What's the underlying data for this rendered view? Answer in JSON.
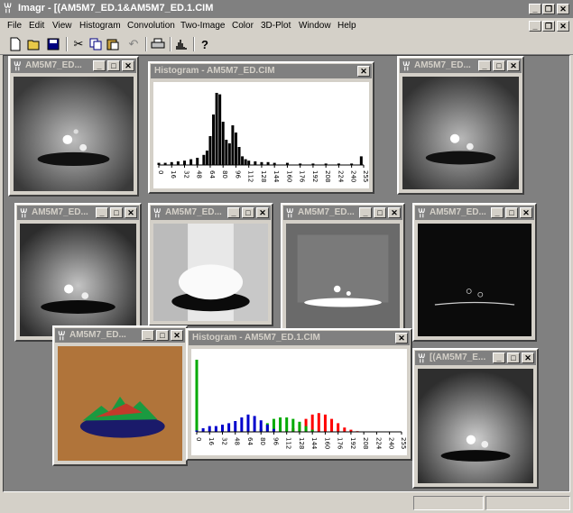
{
  "app": {
    "title": "Imagr - [(AM5M7_ED.1&AM5M7_ED.1.CIM",
    "icon": "app-icon"
  },
  "menu": [
    "File",
    "Edit",
    "View",
    "Histogram",
    "Convolution",
    "Two-Image",
    "Color",
    "3D-Plot",
    "Window",
    "Help"
  ],
  "toolbar": [
    "new-file-icon",
    "open-folder-icon",
    "save-disk-icon",
    "cut-icon",
    "copy-icon",
    "paste-icon",
    "undo-icon",
    "print-icon",
    "histogram-icon",
    "help-icon"
  ],
  "windows": {
    "img1": {
      "title": "AM5M7_ED..."
    },
    "hist1": {
      "title": "Histogram - AM5M7_ED.CIM",
      "ticks": [
        "0",
        "16",
        "32",
        "48",
        "64",
        "80",
        "96",
        "112",
        "128",
        "144",
        "160",
        "176",
        "192",
        "208",
        "224",
        "240",
        "255"
      ]
    },
    "img2": {
      "title": "AM5M7_ED..."
    },
    "img3": {
      "title": "AM5M7_ED..."
    },
    "img4": {
      "title": "AM5M7_ED..."
    },
    "img5": {
      "title": "AM5M7_ED..."
    },
    "img6": {
      "title": "AM5M7_ED..."
    },
    "img7": {
      "title": "AM5M7_ED..."
    },
    "hist2": {
      "title": "Histogram - AM5M7_ED.1.CIM",
      "ticks": [
        "0",
        "16",
        "32",
        "48",
        "64",
        "80",
        "96",
        "112",
        "128",
        "144",
        "160",
        "176",
        "192",
        "208",
        "224",
        "240",
        "255"
      ]
    },
    "img8": {
      "title": "[(AM5M7_E..."
    }
  },
  "colors": {
    "inactive_title": "#808080",
    "face": "#d4d0c8",
    "desktop": "#808080"
  },
  "chart_data": [
    {
      "type": "bar",
      "title": "Histogram - AM5M7_ED.CIM",
      "x": [
        0,
        8,
        16,
        24,
        32,
        40,
        48,
        56,
        60,
        64,
        68,
        72,
        76,
        80,
        84,
        88,
        92,
        96,
        100,
        104,
        108,
        112,
        120,
        128,
        136,
        144,
        160,
        176,
        192,
        208,
        224,
        240,
        252
      ],
      "values": [
        3,
        3,
        4,
        5,
        6,
        8,
        10,
        14,
        20,
        40,
        70,
        100,
        98,
        60,
        35,
        30,
        55,
        45,
        25,
        12,
        8,
        6,
        5,
        4,
        4,
        3,
        3,
        2,
        2,
        2,
        2,
        2,
        12
      ],
      "ylim": [
        0,
        110
      ]
    },
    {
      "type": "bar",
      "title": "Histogram - AM5M7_ED.1.CIM",
      "series": [
        {
          "color": "#ff0000",
          "x": [
            0,
            120,
            128,
            136,
            144,
            152,
            160,
            168,
            176,
            184,
            192,
            200
          ],
          "values": [
            100,
            5,
            10,
            18,
            24,
            26,
            24,
            18,
            12,
            6,
            3,
            1
          ]
        },
        {
          "color": "#00aa00",
          "x": [
            0,
            80,
            88,
            96,
            104,
            112,
            120,
            128,
            136,
            144
          ],
          "values": [
            100,
            4,
            12,
            18,
            20,
            20,
            18,
            14,
            8,
            3
          ]
        },
        {
          "color": "#0000cc",
          "x": [
            0,
            8,
            16,
            24,
            32,
            40,
            48,
            56,
            64,
            72,
            80,
            88,
            96
          ],
          "values": [
            2,
            5,
            8,
            8,
            10,
            12,
            15,
            20,
            24,
            22,
            16,
            10,
            4
          ]
        }
      ],
      "ylim": [
        0,
        110
      ]
    }
  ]
}
